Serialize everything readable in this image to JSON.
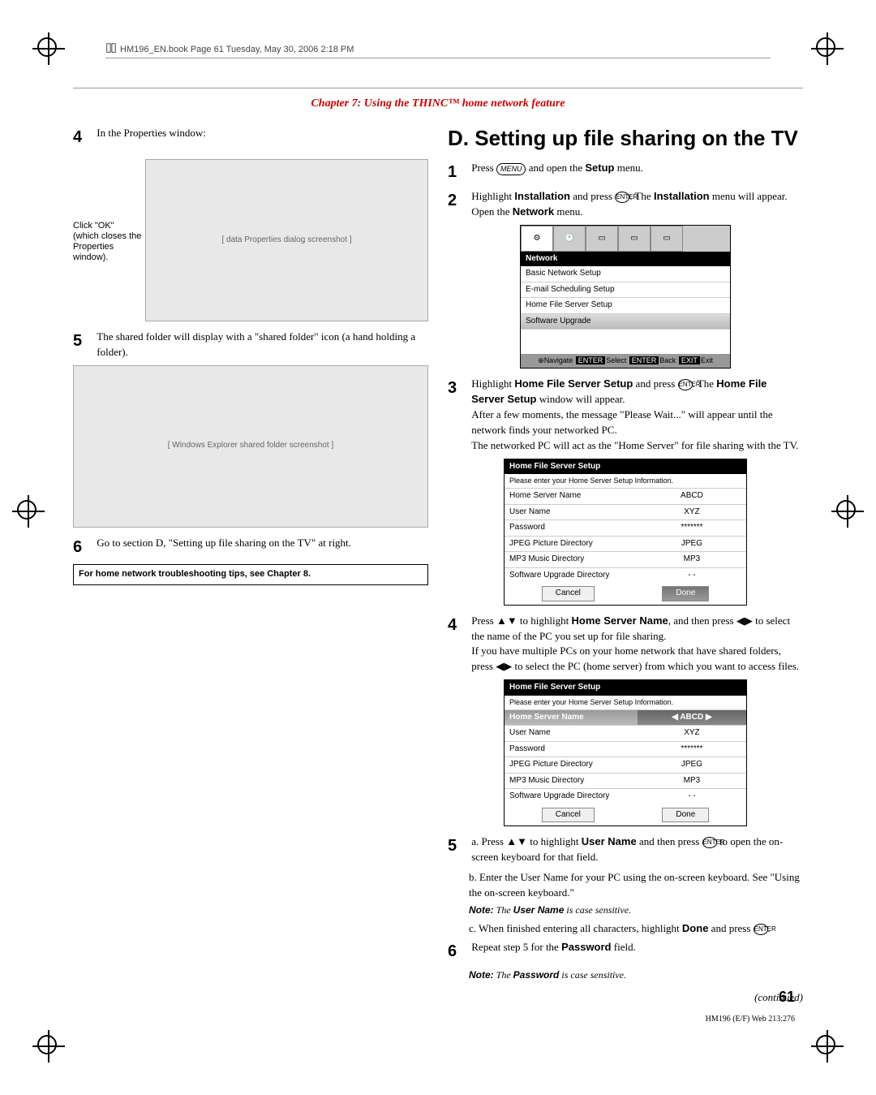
{
  "docHeader": "HM196_EN.book  Page 61  Tuesday, May 30, 2006  2:18 PM",
  "chapter": "Chapter 7: Using the THINC™ home network feature",
  "left": {
    "step4": "In the Properties window:",
    "callout": "Click \"OK\" (which closes the Properties window).",
    "step5": "The shared folder will display with a \"shared folder\" icon (a hand holding a folder).",
    "step6": "Go to section D, \"Setting up file sharing on the TV\" at right.",
    "tip": "For home network troubleshooting tips, see Chapter 8."
  },
  "right": {
    "heading": "D. Setting up file sharing on the TV",
    "step1_a": "Press ",
    "step1_key": "MENU",
    "step1_b": " and open the ",
    "step1_bold": "Setup",
    "step1_c": " menu.",
    "step2_a": "Highlight ",
    "step2_bold1": "Installation",
    "step2_b": " and press ",
    "step2_key": "ENTER",
    "step2_c": ". The ",
    "step2_bold2": "Installation",
    "step2_d": " menu will appear.",
    "step2_e": "Open the ",
    "step2_bold3": "Network",
    "step2_f": " menu.",
    "network_menu": {
      "label": "Network",
      "items": [
        "Basic Network Setup",
        "E-mail Scheduling Setup",
        "Home File Server Setup",
        "Software Upgrade"
      ],
      "nav": {
        "navigate": "Navigate",
        "select": "Select",
        "back": "Back",
        "exit": "Exit"
      }
    },
    "step3_a": "Highlight ",
    "step3_bold1": "Home File Server Setup",
    "step3_b": " and press ",
    "step3_c": ". The ",
    "step3_bold2": "Home File Server Setup",
    "step3_d": " window will appear.",
    "step3_e": "After a few moments, the message \"Please Wait...\" will appear until the network finds your networked PC.",
    "step3_f": "The networked PC will act as the \"Home Server\" for file sharing with the TV.",
    "table1": {
      "title": "Home File Server Setup",
      "sub": "Please enter your Home Server Setup Information.",
      "rows": [
        [
          "Home Server Name",
          "ABCD"
        ],
        [
          "User Name",
          "XYZ"
        ],
        [
          "Password",
          "*******"
        ],
        [
          "JPEG Picture Directory",
          "JPEG"
        ],
        [
          "MP3 Music Directory",
          "MP3"
        ],
        [
          "Software Upgrade Directory",
          "- -"
        ]
      ],
      "cancel": "Cancel",
      "done": "Done"
    },
    "step4_a": "Press ▲▼ to highlight ",
    "step4_bold": "Home Server Name",
    "step4_b": ", and then press ◀▶ to select the name of the PC you set up for file sharing.",
    "step4_c": "If you have multiple PCs on your home network that have shared folders, press ◀▶ to select the PC (home server) from which you want to access files.",
    "table2": {
      "title": "Home File Server Setup",
      "sub": "Please enter your Home Server Setup Information.",
      "rows": [
        [
          "Home Server Name",
          "ABCD"
        ],
        [
          "User Name",
          "XYZ"
        ],
        [
          "Password",
          "*******"
        ],
        [
          "JPEG Picture Directory",
          "JPEG"
        ],
        [
          "MP3 Music Directory",
          "MP3"
        ],
        [
          "Software Upgrade Directory",
          "- -"
        ]
      ],
      "cancel": "Cancel",
      "done": "Done"
    },
    "step5_a_a": "a. Press ▲▼ to highlight ",
    "step5_a_bold": "User Name",
    "step5_a_b": " and then press ",
    "step5_a_c": " to open the on-screen keyboard for that field.",
    "step5_b": "b. Enter the User Name for your PC using the on-screen keyboard. See \"Using the on-screen keyboard.\"",
    "note1_a": "Note:",
    "note1_b": " The ",
    "note1_bold": "User Name",
    "note1_c": " is case sensitive.",
    "step5_c_a": "c. When finished entering all characters, highlight ",
    "step5_c_bold": "Done",
    "step5_c_b": " and press ",
    "step5_c_c": ".",
    "step6_a": "Repeat step 5 for the ",
    "step6_bold": "Password",
    "step6_b": " field.",
    "note2_a": "Note:",
    "note2_b": " The ",
    "note2_bold": "Password",
    "note2_c": " is case sensitive.",
    "continued": "(continued)"
  },
  "pageNum": "61",
  "footer": "HM196 (E/F) Web 213:276"
}
